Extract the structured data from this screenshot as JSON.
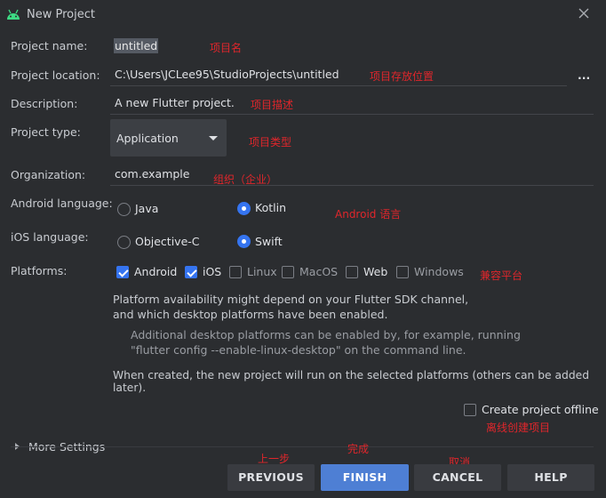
{
  "window": {
    "title": "New Project",
    "android_icon": "android-icon",
    "close_icon": "close-icon"
  },
  "form": {
    "project_name": {
      "label": "Project name:",
      "value": "untitled",
      "annotation": "项目名"
    },
    "project_location": {
      "label": "Project location:",
      "value": "C:\\Users\\JCLee95\\StudioProjects\\untitled",
      "browse": "...",
      "annotation": "项目存放位置"
    },
    "description": {
      "label": "Description:",
      "value": "A new Flutter project.",
      "annotation": "项目描述"
    },
    "project_type": {
      "label": "Project type:",
      "value": "Application",
      "annotation": "项目类型"
    },
    "organization": {
      "label": "Organization:",
      "value": "com.example",
      "annotation": "组织（企业）"
    },
    "android_language": {
      "label": "Android language:",
      "options": [
        {
          "label": "Java",
          "selected": false
        },
        {
          "label": "Kotlin",
          "selected": true
        }
      ],
      "annotation": "Android 语言"
    },
    "ios_language": {
      "label": "iOS language:",
      "options": [
        {
          "label": "Objective-C",
          "selected": false
        },
        {
          "label": "Swift",
          "selected": true
        }
      ]
    },
    "platforms": {
      "label": "Platforms:",
      "items": [
        {
          "label": "Android",
          "checked": true
        },
        {
          "label": "iOS",
          "checked": true
        },
        {
          "label": "Linux",
          "checked": false
        },
        {
          "label": "MacOS",
          "checked": false
        },
        {
          "label": "Web",
          "checked": false
        },
        {
          "label": "Windows",
          "checked": false
        }
      ],
      "annotation": "兼容平台"
    },
    "notes": {
      "availability_line1": "Platform availability might depend on your Flutter SDK channel,",
      "availability_line2": "and which desktop platforms have been enabled.",
      "desktop_line1": "Additional desktop platforms can be enabled by, for example, running",
      "desktop_line2": "\"flutter config --enable-linux-desktop\" on the command line.",
      "created_line": "When created, the new project will run on the selected platforms (others can be added later)."
    },
    "offline": {
      "label": "Create project offline",
      "checked": false,
      "annotation": "离线创建项目"
    },
    "more_settings": "More Settings"
  },
  "buttons": {
    "previous": {
      "label": "PREVIOUS",
      "annotation": "上一步"
    },
    "finish": {
      "label": "FINISH",
      "annotation": "完成"
    },
    "cancel": {
      "label": "CANCEL",
      "annotation": "取消"
    },
    "help": {
      "label": "HELP"
    }
  },
  "colors": {
    "background": "#2b2d30",
    "accent": "#3574f0",
    "annotation": "#e0262b",
    "primary_button": "#4e7fd4"
  }
}
